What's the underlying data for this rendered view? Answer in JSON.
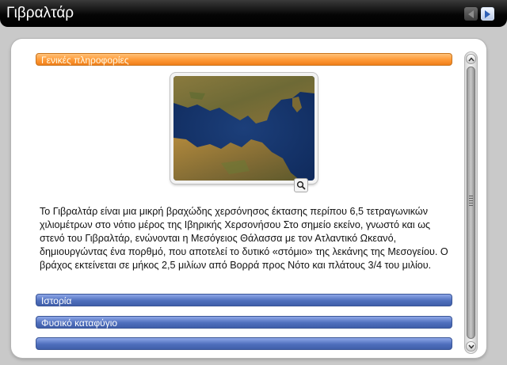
{
  "window": {
    "title": "Γιβραλτάρ",
    "nav": {
      "prev_icon": "arrow-left-icon",
      "next_icon": "arrow-right-icon"
    }
  },
  "accordion": {
    "sections": [
      {
        "label": "Γενικές πληροφορίες",
        "state": "expanded",
        "color": "#ff9c3a"
      },
      {
        "label": "Ιστορία",
        "state": "collapsed",
        "color": "#4f6fbd"
      },
      {
        "label": "Φυσικό καταφύγιο",
        "state": "collapsed",
        "color": "#4f6fbd"
      },
      {
        "label": "",
        "state": "collapsed",
        "color": "#4f6fbd"
      }
    ],
    "content": {
      "image_icon": "satellite-photo-strait-of-gibraltar",
      "zoom_icon": "magnifier-icon",
      "text": "Το Γιβραλτάρ  είναι μια μικρή βραχώδης χερσόνησος έκτασης περίπου 6,5 τετραγωνικών χιλιομέτρων στο νότιο μέρος της Ιβηρικής Χερσονήσου  Στο σημείο εκείνο, γνωστό και ως στενό του Γιβραλτάρ, ενώνονται η Μεσόγειος Θάλασσα με τον Ατλαντικό Ωκεανό, δημιουργώντας ένα πορθμό, που αποτελεί το δυτικό «στόμιο» της λεκάνης της Μεσογείου.  Ο βράχος εκτείνεται σε μήκος 2,5 μιλίων από Βορρά προς Νότο και πλάτους 3/4 του μιλίου."
    }
  },
  "colors": {
    "titlebar": "#000000",
    "panel": "#ffffff",
    "active_header": "#ff9c3a",
    "collapsed_header": "#4f6fbd"
  }
}
